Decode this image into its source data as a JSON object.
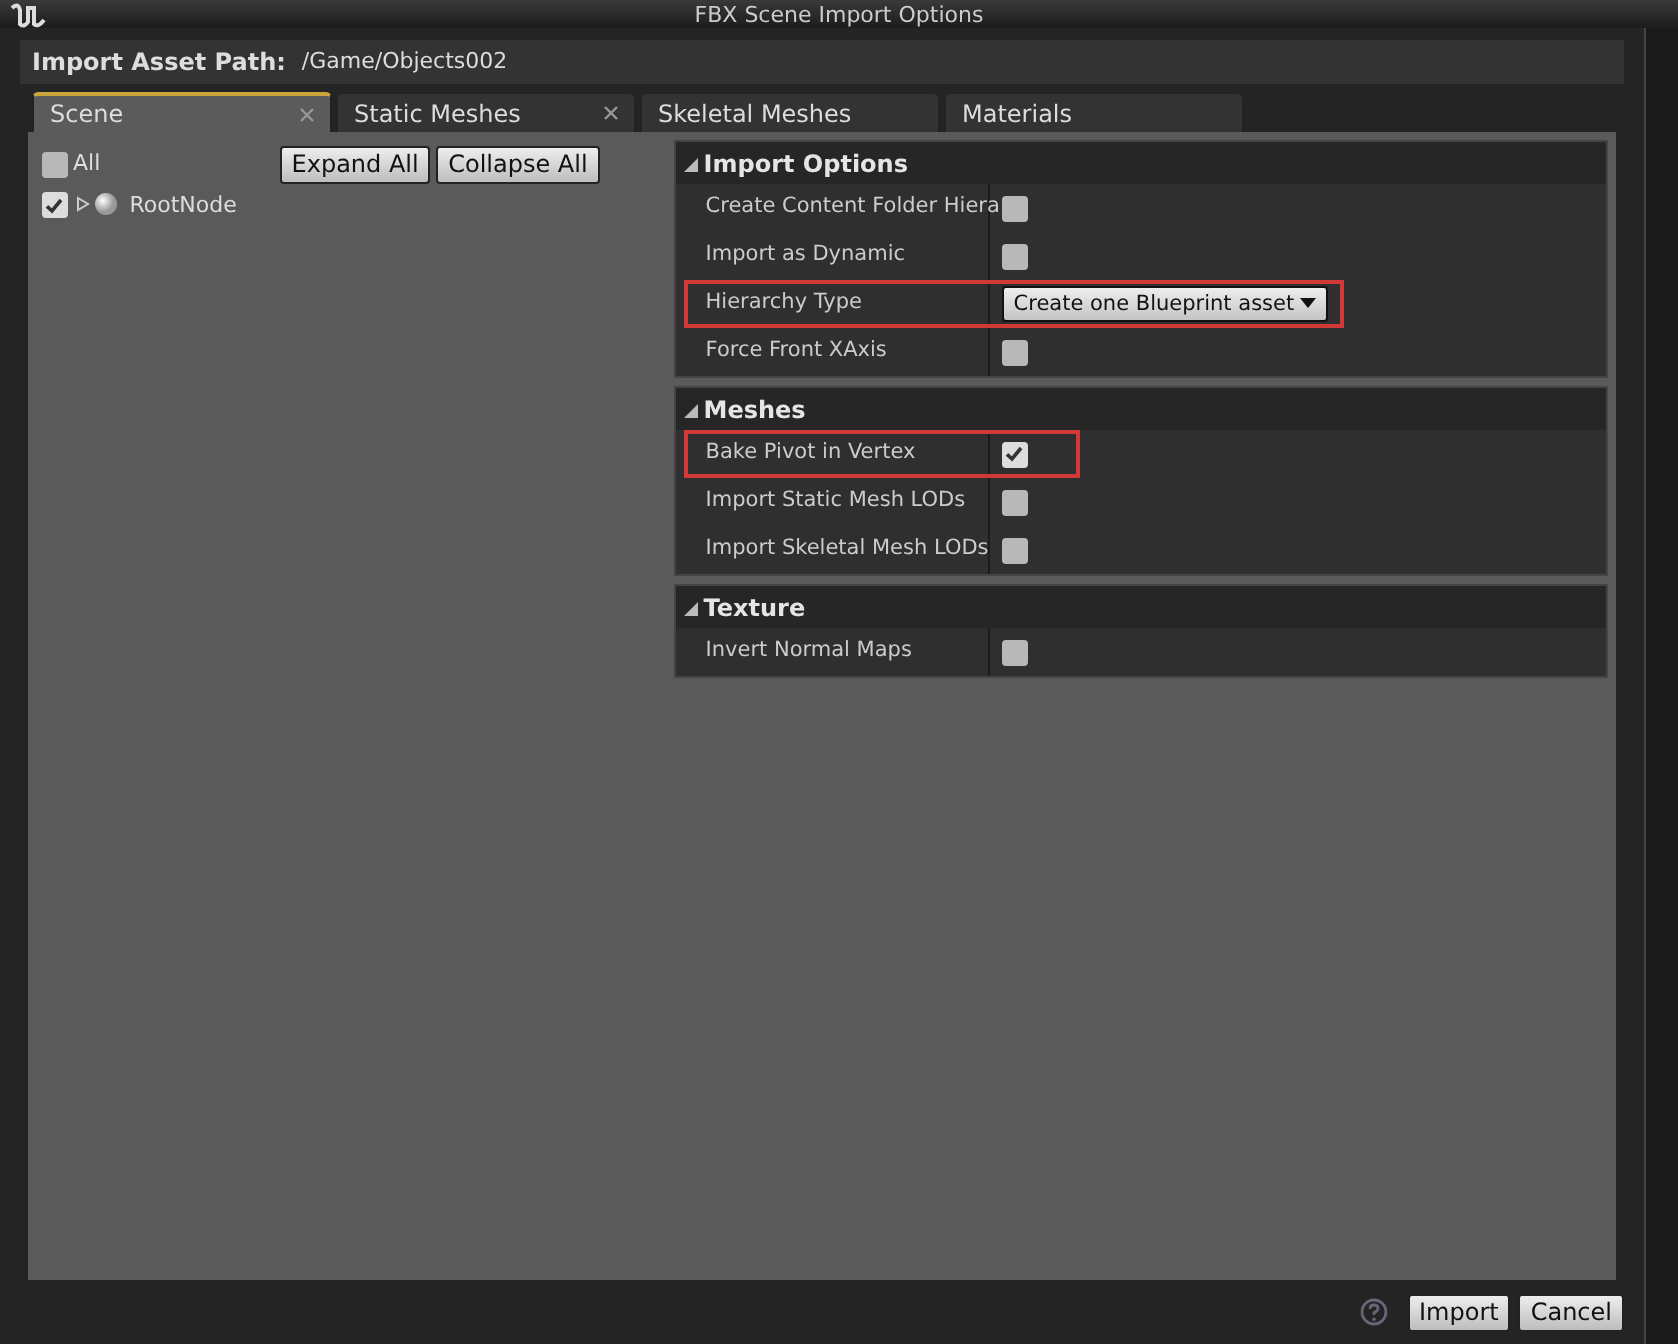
{
  "window": {
    "title": "FBX Scene Import Options"
  },
  "asset_path": {
    "label": "Import Asset Path:",
    "value": "/Game/Objects002"
  },
  "tabs": [
    {
      "label": "Scene",
      "selected": true,
      "closable": true
    },
    {
      "label": "Static Meshes",
      "selected": false,
      "closable": true
    },
    {
      "label": "Skeletal Meshes",
      "selected": false,
      "closable": false
    },
    {
      "label": "Materials",
      "selected": false,
      "closable": false
    }
  ],
  "scene": {
    "all": {
      "label": "All",
      "checked": false
    },
    "buttons": [
      "Expand All",
      "Collapse All"
    ],
    "nodes": [
      {
        "label": "RootNode",
        "checked": true,
        "expanded": false
      }
    ]
  },
  "sections": [
    {
      "title": "Import Options",
      "expanded": true,
      "rows": [
        {
          "label": "Create Content Folder Hiera",
          "kind": "checkbox",
          "checked": false,
          "highlighted": false
        },
        {
          "label": "Import as Dynamic",
          "kind": "checkbox",
          "checked": false,
          "highlighted": false
        },
        {
          "label": "Hierarchy Type",
          "kind": "dropdown",
          "value": "Create one Blueprint asset",
          "highlighted": true
        },
        {
          "label": "Force Front XAxis",
          "kind": "checkbox",
          "checked": false,
          "highlighted": false
        }
      ]
    },
    {
      "title": "Meshes",
      "expanded": true,
      "rows": [
        {
          "label": "Bake Pivot in Vertex",
          "kind": "checkbox",
          "checked": true,
          "highlighted": true
        },
        {
          "label": "Import Static Mesh LODs",
          "kind": "checkbox",
          "checked": false,
          "highlighted": false
        },
        {
          "label": "Import Skeletal Mesh LODs",
          "kind": "checkbox",
          "checked": false,
          "highlighted": false
        }
      ]
    },
    {
      "title": "Texture",
      "expanded": true,
      "rows": [
        {
          "label": "Invert Normal Maps",
          "kind": "checkbox",
          "checked": false,
          "highlighted": false
        }
      ]
    }
  ],
  "footer": {
    "buttons": [
      "Import",
      "Cancel"
    ]
  }
}
